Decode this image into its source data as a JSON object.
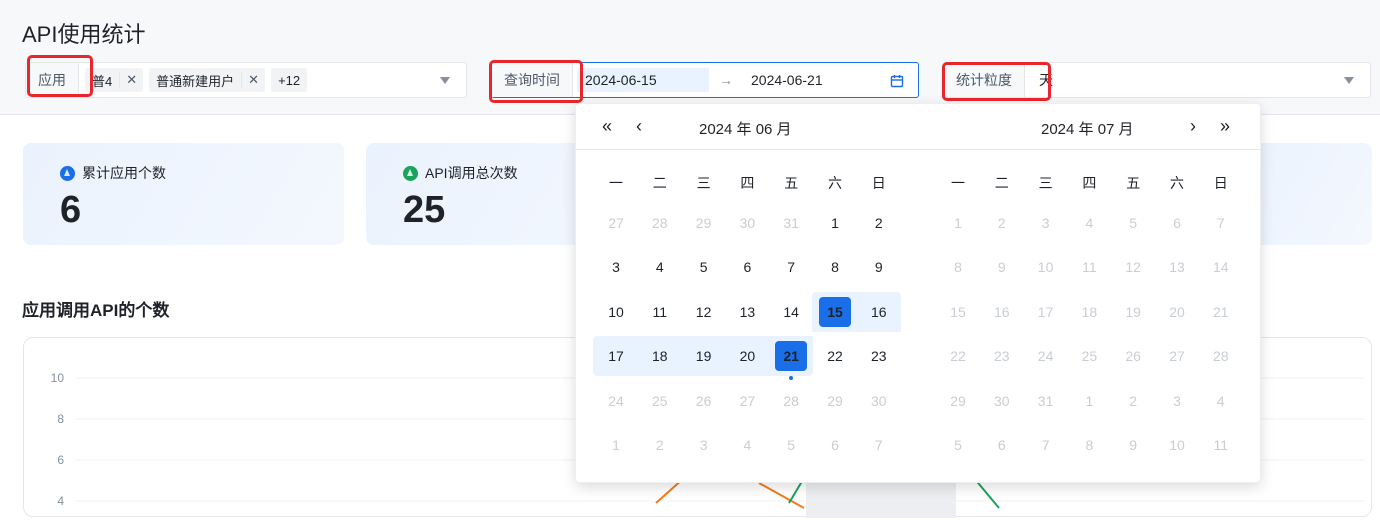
{
  "page": {
    "title": "API使用统计"
  },
  "filters": {
    "app": {
      "label": "应用",
      "tags": [
        "普4",
        "普通新建用户"
      ],
      "more": "+12"
    },
    "time": {
      "label": "查询时间",
      "start": "2024-06-15",
      "end": "2024-06-21",
      "arrow": "→"
    },
    "granularity": {
      "label": "统计粒度",
      "value": "天"
    }
  },
  "cards": [
    {
      "label": "累计应用个数",
      "value": "6",
      "color": "#1a6fe8"
    },
    {
      "label": "API调用总次数",
      "value": "25",
      "color": "#1aa35b"
    }
  ],
  "section": {
    "title": "应用调用API的个数"
  },
  "chart_data": {
    "type": "line",
    "title": "应用调用API的个数",
    "yticks": [
      "10",
      "8",
      "6",
      "4"
    ],
    "ylim": [
      4,
      10
    ]
  },
  "calendar": {
    "left_title": "2024 年 06 月",
    "right_title": "2024 年 07 月",
    "weekdays": [
      "一",
      "二",
      "三",
      "四",
      "五",
      "六",
      "日"
    ],
    "left_days": [
      [
        "27",
        "28",
        "29",
        "30",
        "31",
        "1",
        "2"
      ],
      [
        "3",
        "4",
        "5",
        "6",
        "7",
        "8",
        "9"
      ],
      [
        "10",
        "11",
        "12",
        "13",
        "14",
        "15",
        "16"
      ],
      [
        "17",
        "18",
        "19",
        "20",
        "21",
        "22",
        "23"
      ],
      [
        "24",
        "25",
        "26",
        "27",
        "28",
        "29",
        "30"
      ],
      [
        "1",
        "2",
        "3",
        "4",
        "5",
        "6",
        "7"
      ]
    ],
    "right_days": [
      [
        "1",
        "2",
        "3",
        "4",
        "5",
        "6",
        "7"
      ],
      [
        "8",
        "9",
        "10",
        "11",
        "12",
        "13",
        "14"
      ],
      [
        "15",
        "16",
        "17",
        "18",
        "19",
        "20",
        "21"
      ],
      [
        "22",
        "23",
        "24",
        "25",
        "26",
        "27",
        "28"
      ],
      [
        "29",
        "30",
        "31",
        "1",
        "2",
        "3",
        "4"
      ],
      [
        "5",
        "6",
        "7",
        "8",
        "9",
        "10",
        "11"
      ]
    ],
    "selected_start": "15",
    "selected_end": "21"
  }
}
